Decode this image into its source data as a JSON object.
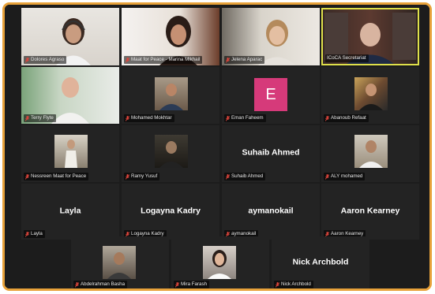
{
  "meeting": {
    "row1": [
      {
        "name": "Dolores Agraso",
        "active": false
      },
      {
        "name": "Maat for Peace - Marina Mikhail",
        "active": false
      },
      {
        "name": "Jelena Aparac",
        "active": false
      },
      {
        "name": "ICoCA Secretariat",
        "active": true
      }
    ],
    "row2": [
      {
        "name": "Terry Flyte"
      },
      {
        "name": "Mohamed Mokhtar"
      },
      {
        "name": "Eman Faheem",
        "avatar_letter": "E",
        "avatar_color": "#d63a7a"
      },
      {
        "name": "Abanoub Refaat"
      }
    ],
    "row3": [
      {
        "name": "Nessreen Maat for Peace"
      },
      {
        "name": "Ramy Yusuf"
      },
      {
        "name": "Suhaib Ahmed",
        "display_name": "Suhaib Ahmed"
      },
      {
        "name": "ALY mohamed"
      }
    ],
    "row4": [
      {
        "name": "Layla",
        "display_name": "Layla"
      },
      {
        "name": "Logayna Kadry",
        "display_name": "Logayna Kadry"
      },
      {
        "name": "aymanokail",
        "display_name": "aymanokail"
      },
      {
        "name": "Aaron Kearney",
        "display_name": "Aaron Kearney"
      }
    ],
    "row5": [
      {
        "name": "Abdelrahman Basha"
      },
      {
        "name": "Mira Farash"
      },
      {
        "name": "Nick Archbold",
        "display_name": "Nick Archbold"
      }
    ]
  },
  "colors": {
    "frame_border": "#e8a23a",
    "active_speaker_border": "#dfe04a",
    "tile_background": "#232323",
    "muted_mic": "#e0463c"
  },
  "icons": {
    "muted": "mic-muted-icon"
  }
}
